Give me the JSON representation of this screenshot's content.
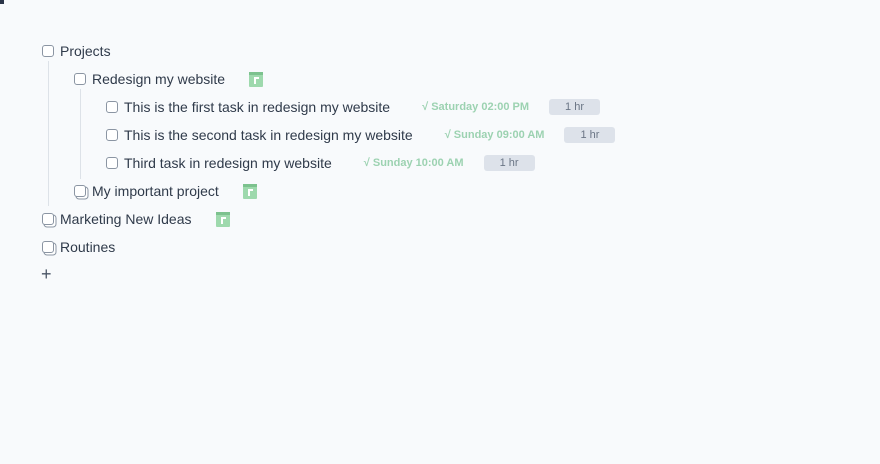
{
  "tree": {
    "projects": {
      "label": "Projects"
    },
    "redesign": {
      "label": "Redesign my website"
    },
    "tasks": [
      {
        "label": "This is the first task in redesign my website",
        "due": "√ Saturday 02:00 PM",
        "duration": "1 hr"
      },
      {
        "label": "This is the second task in redesign my website",
        "due": "√ Sunday 09:00 AM",
        "duration": "1 hr"
      },
      {
        "label": "Third task in redesign my website",
        "due": "√ Sunday 10:00 AM",
        "duration": "1 hr"
      }
    ],
    "important": {
      "label": "My important project"
    },
    "marketing": {
      "label": "Marketing New Ideas"
    },
    "routines": {
      "label": "Routines"
    }
  },
  "add_button": {
    "symbol": "+"
  },
  "icons": {
    "checkbox": "checkbox-icon",
    "calendar": "calendar-icon",
    "add": "plus-icon"
  },
  "colors": {
    "background": "#f8fafc",
    "text": "#2f3a4a",
    "due_text": "#9cd2b1",
    "calendar": "#9ed9ad",
    "badge_bg": "#dde2ea",
    "badge_text": "#6a7585"
  }
}
